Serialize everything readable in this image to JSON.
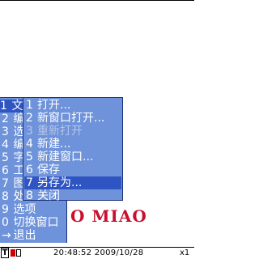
{
  "document": {
    "visible_text": "O MIAO"
  },
  "main_menu": {
    "items": [
      {
        "num": "1",
        "label": "文"
      },
      {
        "num": "2",
        "label": "编"
      },
      {
        "num": "3",
        "label": "选"
      },
      {
        "num": "4",
        "label": "编"
      },
      {
        "num": "5",
        "label": "字"
      },
      {
        "num": "6",
        "label": "工"
      },
      {
        "num": "7",
        "label": "图"
      },
      {
        "num": "8",
        "label": "处"
      },
      {
        "num": "9",
        "label": "选项"
      },
      {
        "num": "0",
        "label": "切换窗口"
      },
      {
        "num": "→",
        "label": "退出"
      }
    ]
  },
  "sub_menu": {
    "items": [
      {
        "num": "1",
        "label": "打开..."
      },
      {
        "num": "2",
        "label": "新窗口打开..."
      },
      {
        "num": "3",
        "label": "重新打开"
      },
      {
        "num": "4",
        "label": "新建..."
      },
      {
        "num": "5",
        "label": "新建窗口..."
      },
      {
        "num": "6",
        "label": "保存"
      },
      {
        "num": "7",
        "label": "另存为..."
      },
      {
        "num": "8",
        "label": "关闭"
      }
    ]
  },
  "status": {
    "mode": "T",
    "clock_prefix": "48:2",
    "datetime": "20:48:52 2009/10/28",
    "zoom": "x1"
  },
  "colors": {
    "menu_bg": "#6f93da",
    "menu_selected": "#2e55c2",
    "doc_text": "#c8102e"
  }
}
